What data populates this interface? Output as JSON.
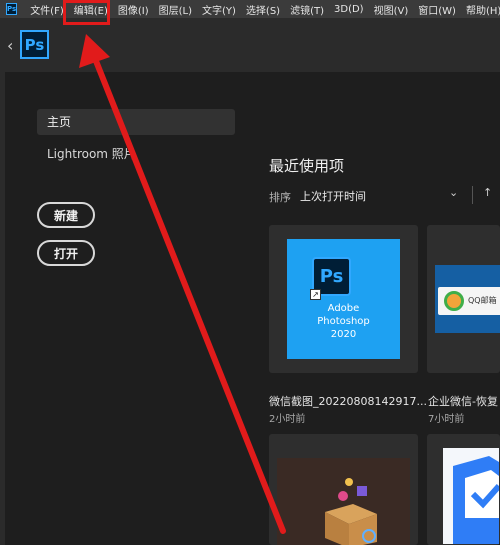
{
  "menubar": {
    "app_icon_label": "Ps",
    "items": [
      "文件(F)",
      "编辑(E)",
      "图像(I)",
      "图层(L)",
      "文字(Y)",
      "选择(S)",
      "滤镜(T)",
      "3D(D)",
      "视图(V)",
      "窗口(W)",
      "帮助(H)"
    ]
  },
  "topbar": {
    "back_glyph": "‹",
    "logo_label": "Ps"
  },
  "sidebar": {
    "home_label": "主页",
    "lightroom_label": "Lightroom 照片",
    "new_label": "新建",
    "open_label": "打开"
  },
  "recent": {
    "title": "最近使用项",
    "sort_label": "排序",
    "sort_value": "上次打开时间",
    "sort_chevron": "⌄",
    "sort_direction_glyph": "↑"
  },
  "cards": [
    {
      "thumb_icon_label": "Ps",
      "thumb_shortcut_glyph": "↗",
      "thumb_caption_lines": [
        "Adobe",
        "Photoshop",
        "2020"
      ],
      "name": "微信截图_20220808142917...",
      "time": "2小时前"
    },
    {
      "thumb_caption": "QQ邮箱",
      "name": "企业微信-恢复",
      "time": "7小时前"
    }
  ],
  "annotation_colors": {
    "arrow": "#e11b1b",
    "highlight": "#e11b1b"
  }
}
